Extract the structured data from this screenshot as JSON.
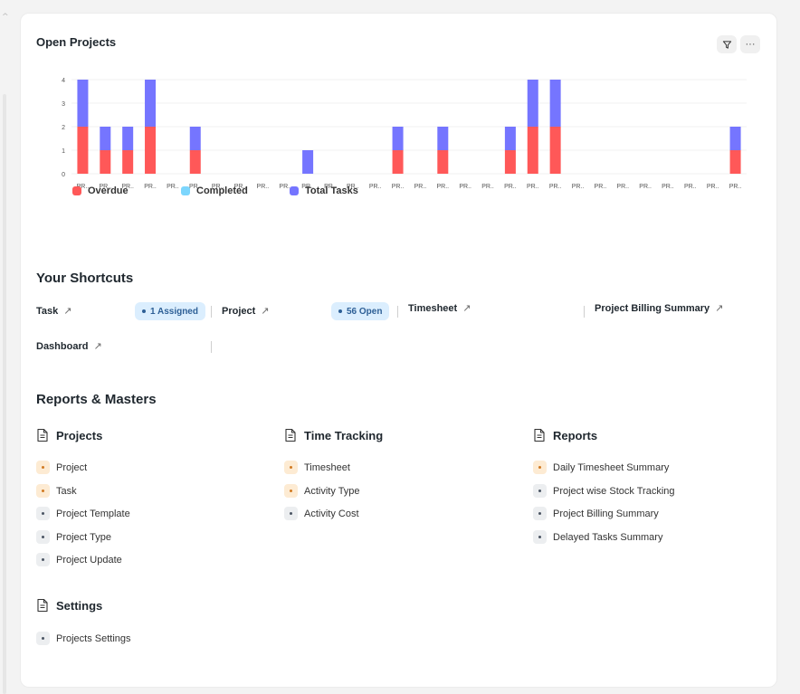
{
  "chart_data": {
    "type": "bar",
    "stacked": true,
    "title": "Open Projects",
    "categories": [
      "PR..",
      "PR..",
      "PR..",
      "PR..",
      "PR..",
      "PR..",
      "PR..",
      "PR..",
      "PR..",
      "PR..",
      "PR..",
      "PR..",
      "PR..",
      "PR..",
      "PR..",
      "PR..",
      "PR..",
      "PR..",
      "PR..",
      "PR..",
      "PR..",
      "PR..",
      "PR..",
      "PR..",
      "PR..",
      "PR..",
      "PR..",
      "PR..",
      "PR..",
      "PR.."
    ],
    "series": [
      {
        "name": "Overdue",
        "color": "#ff5858",
        "values": [
          2,
          1,
          1,
          2,
          0,
          1,
          0,
          0,
          0,
          0,
          0,
          0,
          0,
          0,
          1,
          0,
          1,
          0,
          0,
          1,
          2,
          2,
          0,
          0,
          0,
          0,
          0,
          0,
          0,
          1
        ]
      },
      {
        "name": "Completed",
        "color": "#7cd6fd",
        "values": [
          0,
          0,
          0,
          0,
          0,
          0,
          0,
          0,
          0,
          0,
          0,
          0,
          0,
          0,
          0,
          0,
          0,
          0,
          0,
          0,
          0,
          0,
          0,
          0,
          0,
          0,
          0,
          0,
          0,
          0
        ]
      },
      {
        "name": "Total Tasks",
        "color": "#7575ff",
        "values": [
          2,
          1,
          1,
          2,
          0,
          1,
          0,
          0,
          0,
          0,
          1,
          0,
          0,
          0,
          1,
          0,
          1,
          0,
          0,
          1,
          2,
          2,
          0,
          0,
          0,
          0,
          0,
          0,
          0,
          1
        ]
      }
    ],
    "yticks": [
      0,
      1,
      2,
      3,
      4
    ],
    "ylim": [
      0,
      4
    ],
    "grid": true,
    "legend": "bottom-left"
  },
  "header": {
    "title": "Open Projects",
    "filter_icon": "filter-icon",
    "more_icon": "more-horizontal-icon",
    "more_label": "···"
  },
  "shortcuts": {
    "title": "Your Shortcuts",
    "items": [
      {
        "label": "Task",
        "badge": "1 Assigned"
      },
      {
        "label": "Project",
        "badge": "56 Open"
      },
      {
        "label": "Timesheet"
      },
      {
        "label": "Project Billing Summary"
      },
      {
        "label": "Dashboard"
      }
    ],
    "arrow": "↗"
  },
  "reports": {
    "title": "Reports & Masters",
    "columns": [
      {
        "title": "Projects",
        "items": [
          {
            "label": "Project",
            "tone": "orange"
          },
          {
            "label": "Task",
            "tone": "orange"
          },
          {
            "label": "Project Template",
            "tone": "gray"
          },
          {
            "label": "Project Type",
            "tone": "gray"
          },
          {
            "label": "Project Update",
            "tone": "gray"
          }
        ]
      },
      {
        "title": "Time Tracking",
        "items": [
          {
            "label": "Timesheet",
            "tone": "orange"
          },
          {
            "label": "Activity Type",
            "tone": "orange"
          },
          {
            "label": "Activity Cost",
            "tone": "gray"
          }
        ]
      },
      {
        "title": "Reports",
        "items": [
          {
            "label": "Daily Timesheet Summary",
            "tone": "orange"
          },
          {
            "label": "Project wise Stock Tracking",
            "tone": "gray"
          },
          {
            "label": "Project Billing Summary",
            "tone": "gray"
          },
          {
            "label": "Delayed Tasks Summary",
            "tone": "gray"
          }
        ]
      },
      {
        "title": "Settings",
        "items": [
          {
            "label": "Projects Settings",
            "tone": "gray"
          }
        ]
      }
    ]
  }
}
